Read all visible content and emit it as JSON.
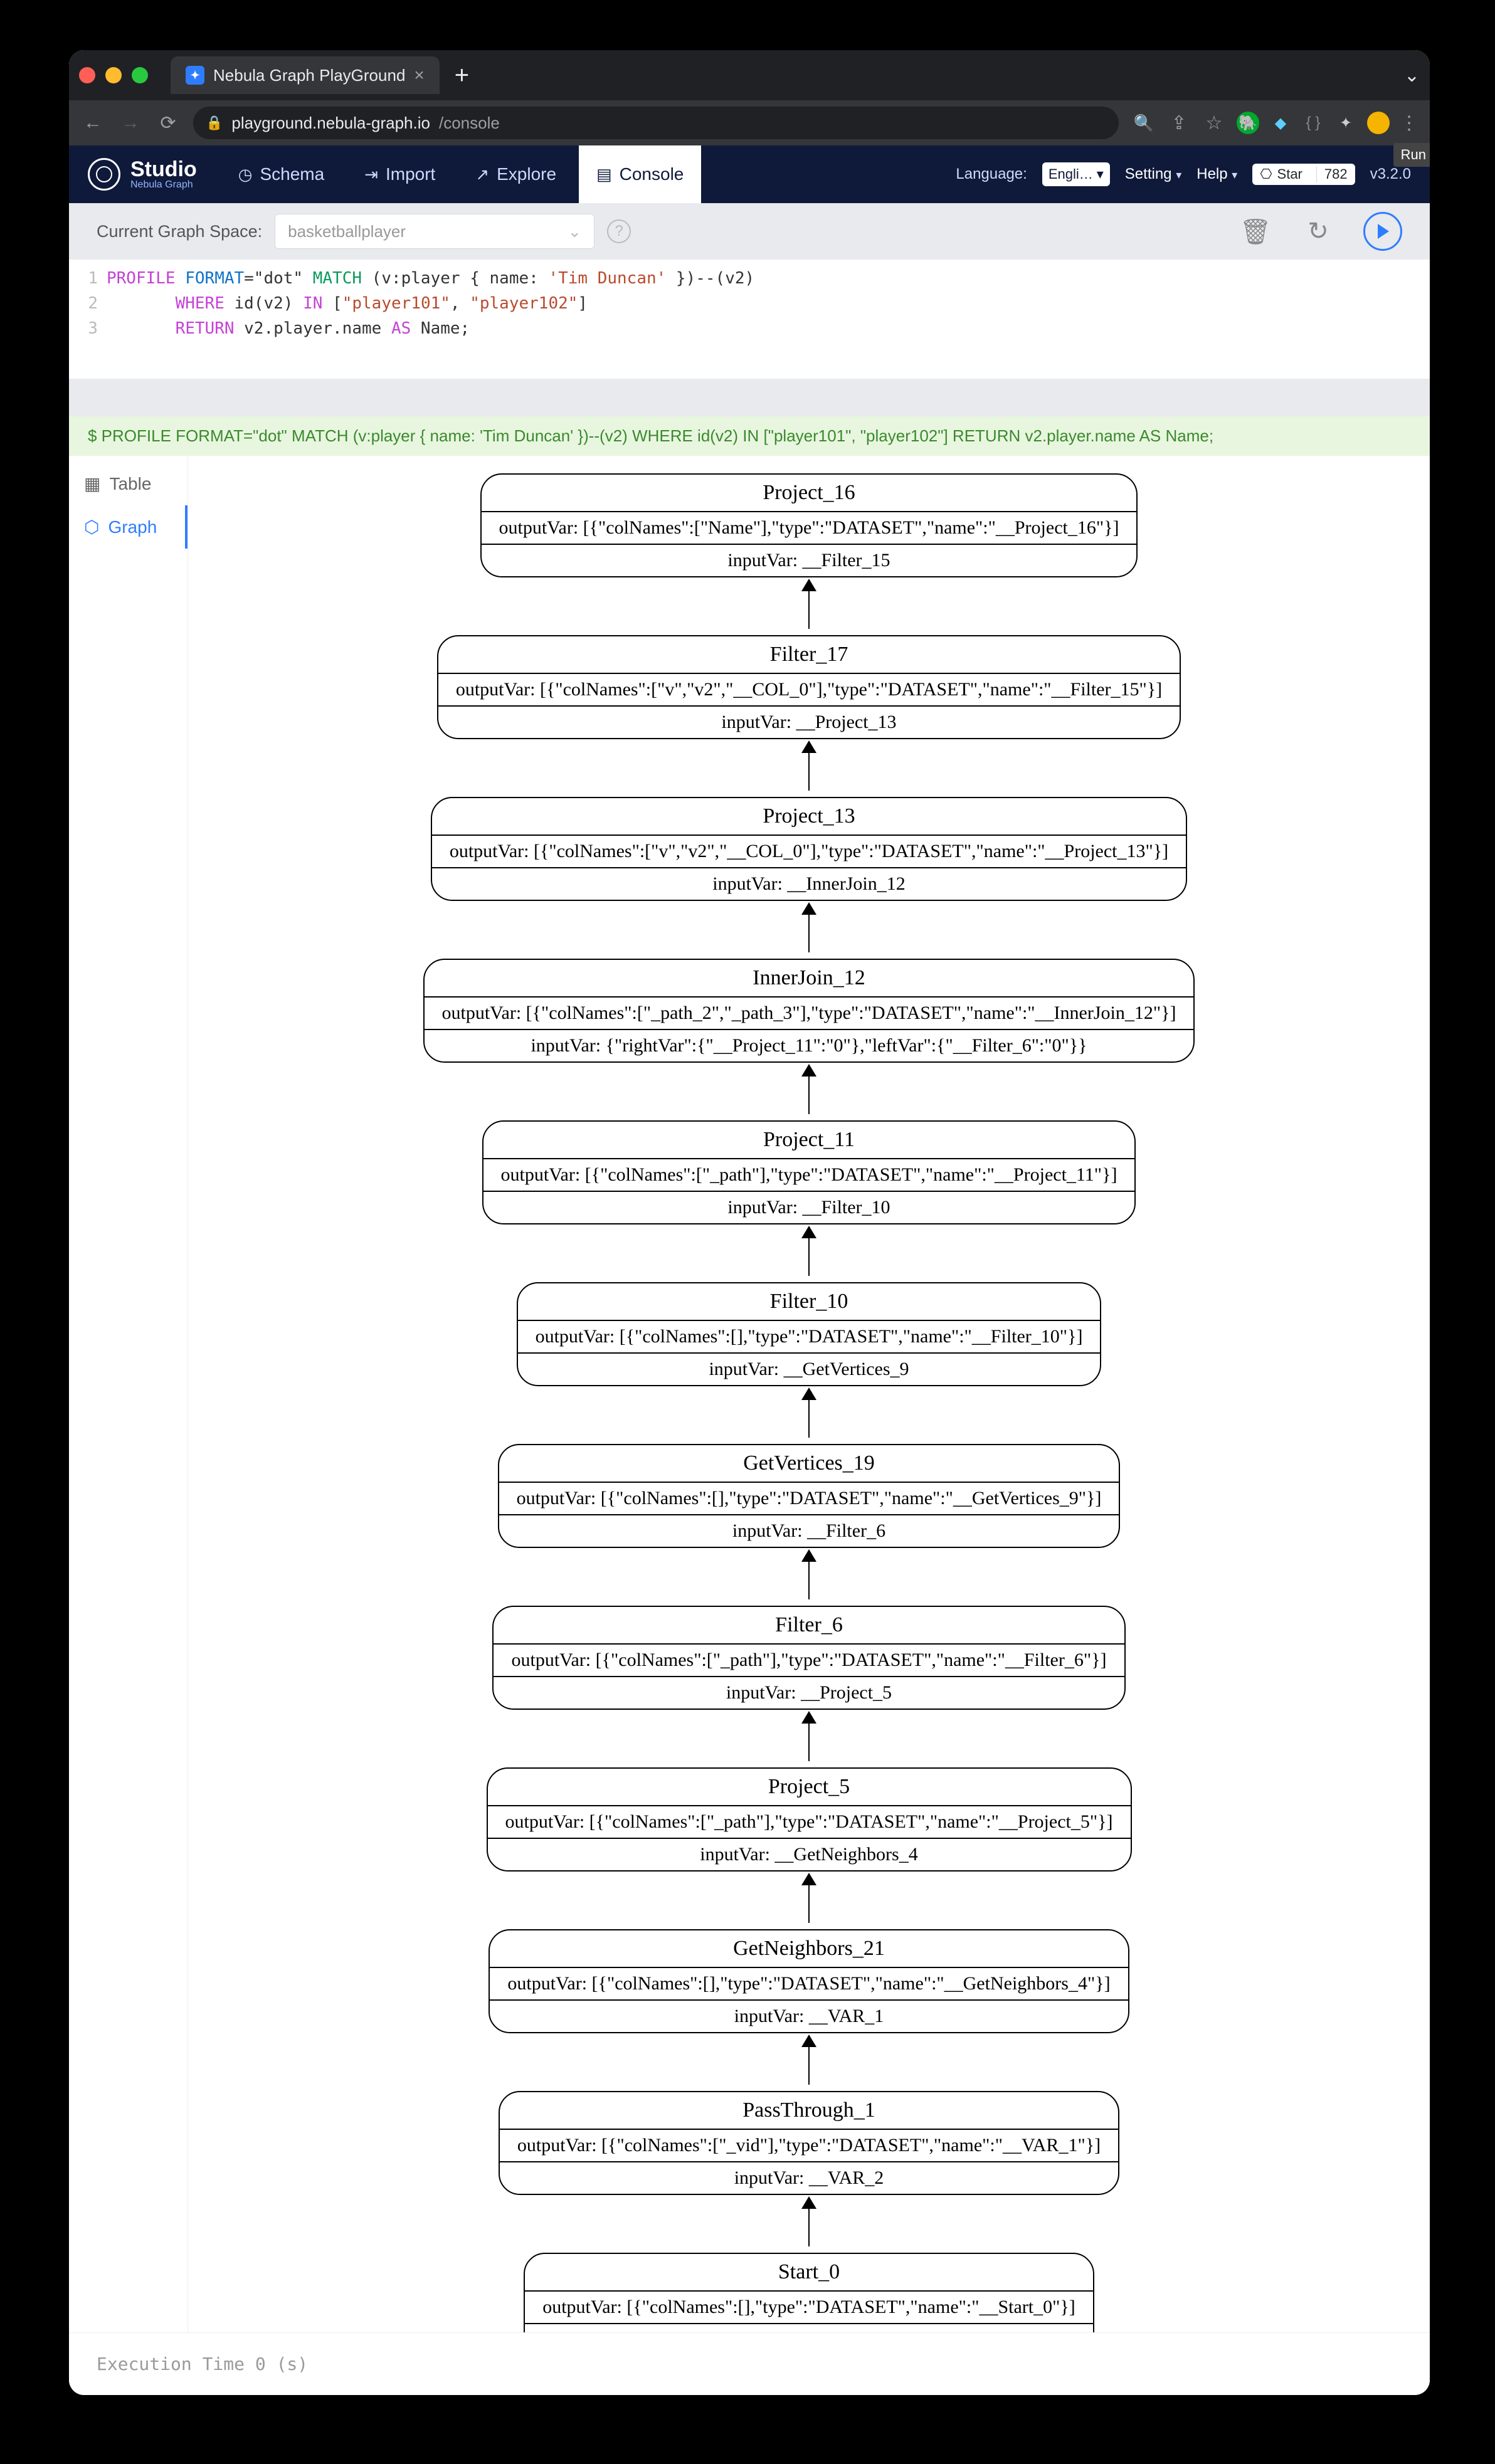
{
  "browser": {
    "tab_title": "Nebula Graph PlayGround",
    "url_domain": "playground.nebula-graph.io",
    "url_path": "/console"
  },
  "studio": {
    "brand_title": "Studio",
    "brand_sub": "Nebula Graph",
    "nav": {
      "schema": "Schema",
      "import": "Import",
      "explore": "Explore",
      "console": "Console"
    },
    "language_label": "Language:",
    "language_value": "Engli…",
    "setting": "Setting",
    "help": "Help",
    "gh_star": "Star",
    "gh_count": "782",
    "version": "v3.2.0"
  },
  "spacebar": {
    "label": "Current Graph Space:",
    "value": "basketballplayer"
  },
  "run_tooltip": "Run",
  "editor": {
    "line1_a": "PROFILE",
    "line1_b": "FORMAT",
    "line1_c": "=\"dot\"",
    "line1_d": "MATCH",
    "line1_e": " (v:player { name: ",
    "line1_f": "'Tim Duncan'",
    "line1_g": " })--(v2)",
    "line2_a": "WHERE",
    "line2_b": " id(v2) ",
    "line2_c": "IN",
    "line2_d": " [",
    "line2_e": "\"player101\"",
    "line2_f": ", ",
    "line2_g": "\"player102\"",
    "line2_h": "]",
    "line3_a": "RETURN",
    "line3_b": " v2.player.name ",
    "line3_c": "AS",
    "line3_d": " Name;"
  },
  "echo": "$ PROFILE FORMAT=\"dot\" MATCH (v:player { name: 'Tim Duncan' })--(v2) WHERE id(v2) IN [\"player101\", \"player102\"] RETURN v2.player.name AS Name;",
  "side_tabs": {
    "table": "Table",
    "graph": "Graph"
  },
  "plan": [
    {
      "title": "Project_16",
      "out": "outputVar: [{\"colNames\":[\"Name\"],\"type\":\"DATASET\",\"name\":\"__Project_16\"}]",
      "in": "inputVar: __Filter_15"
    },
    {
      "title": "Filter_17",
      "out": "outputVar: [{\"colNames\":[\"v\",\"v2\",\"__COL_0\"],\"type\":\"DATASET\",\"name\":\"__Filter_15\"}]",
      "in": "inputVar: __Project_13"
    },
    {
      "title": "Project_13",
      "out": "outputVar: [{\"colNames\":[\"v\",\"v2\",\"__COL_0\"],\"type\":\"DATASET\",\"name\":\"__Project_13\"}]",
      "in": "inputVar: __InnerJoin_12"
    },
    {
      "title": "InnerJoin_12",
      "out": "outputVar: [{\"colNames\":[\"_path_2\",\"_path_3\"],\"type\":\"DATASET\",\"name\":\"__InnerJoin_12\"}]",
      "in": "inputVar: {\"rightVar\":{\"__Project_11\":\"0\"},\"leftVar\":{\"__Filter_6\":\"0\"}}"
    },
    {
      "title": "Project_11",
      "out": "outputVar: [{\"colNames\":[\"_path\"],\"type\":\"DATASET\",\"name\":\"__Project_11\"}]",
      "in": "inputVar: __Filter_10"
    },
    {
      "title": "Filter_10",
      "out": "outputVar: [{\"colNames\":[],\"type\":\"DATASET\",\"name\":\"__Filter_10\"}]",
      "in": "inputVar: __GetVertices_9"
    },
    {
      "title": "GetVertices_19",
      "out": "outputVar: [{\"colNames\":[],\"type\":\"DATASET\",\"name\":\"__GetVertices_9\"}]",
      "in": "inputVar: __Filter_6"
    },
    {
      "title": "Filter_6",
      "out": "outputVar: [{\"colNames\":[\"_path\"],\"type\":\"DATASET\",\"name\":\"__Filter_6\"}]",
      "in": "inputVar: __Project_5"
    },
    {
      "title": "Project_5",
      "out": "outputVar: [{\"colNames\":[\"_path\"],\"type\":\"DATASET\",\"name\":\"__Project_5\"}]",
      "in": "inputVar: __GetNeighbors_4"
    },
    {
      "title": "GetNeighbors_21",
      "out": "outputVar: [{\"colNames\":[],\"type\":\"DATASET\",\"name\":\"__GetNeighbors_4\"}]",
      "in": "inputVar: __VAR_1"
    },
    {
      "title": "PassThrough_1",
      "out": "outputVar: [{\"colNames\":[\"_vid\"],\"type\":\"DATASET\",\"name\":\"__VAR_1\"}]",
      "in": "inputVar: __VAR_2"
    },
    {
      "title": "Start_0",
      "out": "outputVar: [{\"colNames\":[],\"type\":\"DATASET\",\"name\":\"__Start_0\"}]",
      "in": "inputVar:"
    }
  ],
  "footer": "Execution Time 0 (s)"
}
